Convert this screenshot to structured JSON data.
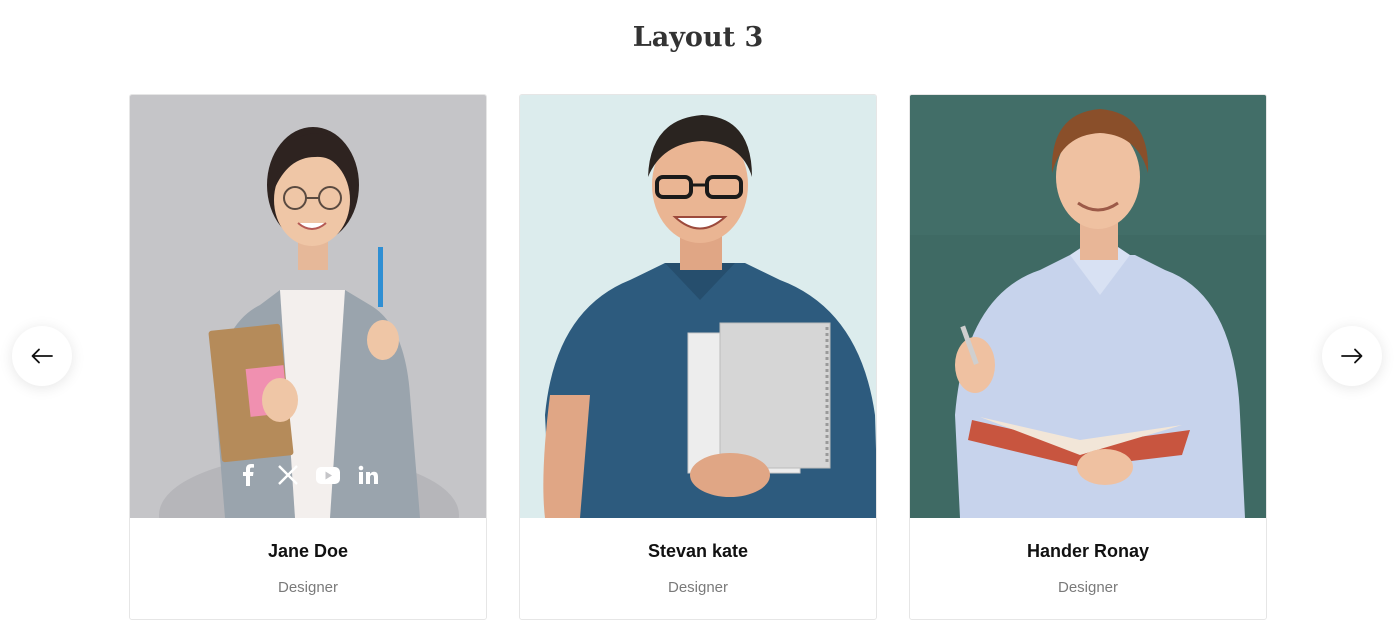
{
  "section": {
    "title": "Layout 3"
  },
  "members": [
    {
      "name": "Jane Doe",
      "role": "Designer"
    },
    {
      "name": "Stevan kate",
      "role": "Designer"
    },
    {
      "name": "Hander Ronay",
      "role": "Designer"
    }
  ],
  "socials": [
    "facebook-icon",
    "x-twitter-icon",
    "youtube-icon",
    "linkedin-icon"
  ],
  "colors": {
    "title": "#333333",
    "name": "#111111",
    "role": "#7a7a7a",
    "card_border": "#e6e6e6"
  },
  "icons": {
    "prev": "arrow-left-icon",
    "next": "arrow-right-icon"
  }
}
